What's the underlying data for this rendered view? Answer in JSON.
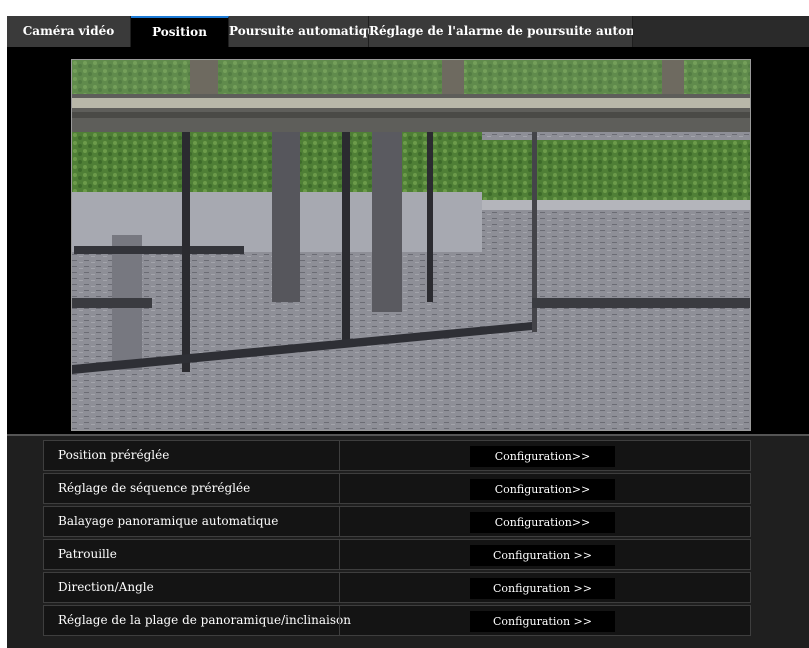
{
  "tabs": [
    {
      "label": "Caméra vidéo"
    },
    {
      "label": "Position"
    },
    {
      "label": "Poursuite automatique"
    },
    {
      "label": "Réglage de l'alarme de poursuite automatique"
    }
  ],
  "active_tab": "Position",
  "rows": [
    {
      "label": "Position préréglée",
      "button": "Configuration>>"
    },
    {
      "label": "Réglage de séquence préréglée",
      "button": "Configuration>>"
    },
    {
      "label": "Balayage panoramique automatique",
      "button": "Configuration>>"
    },
    {
      "label": "Patrouille",
      "button": "Configuration >>"
    },
    {
      "label": "Direction/Angle",
      "button": "Configuration >>"
    },
    {
      "label": "Réglage de la plage de panoramique/inclinaison",
      "button": "Configuration >>"
    }
  ],
  "colors": {
    "accent": "#1d7bd6",
    "panel": "#1f1f1f",
    "button": "#000000"
  }
}
